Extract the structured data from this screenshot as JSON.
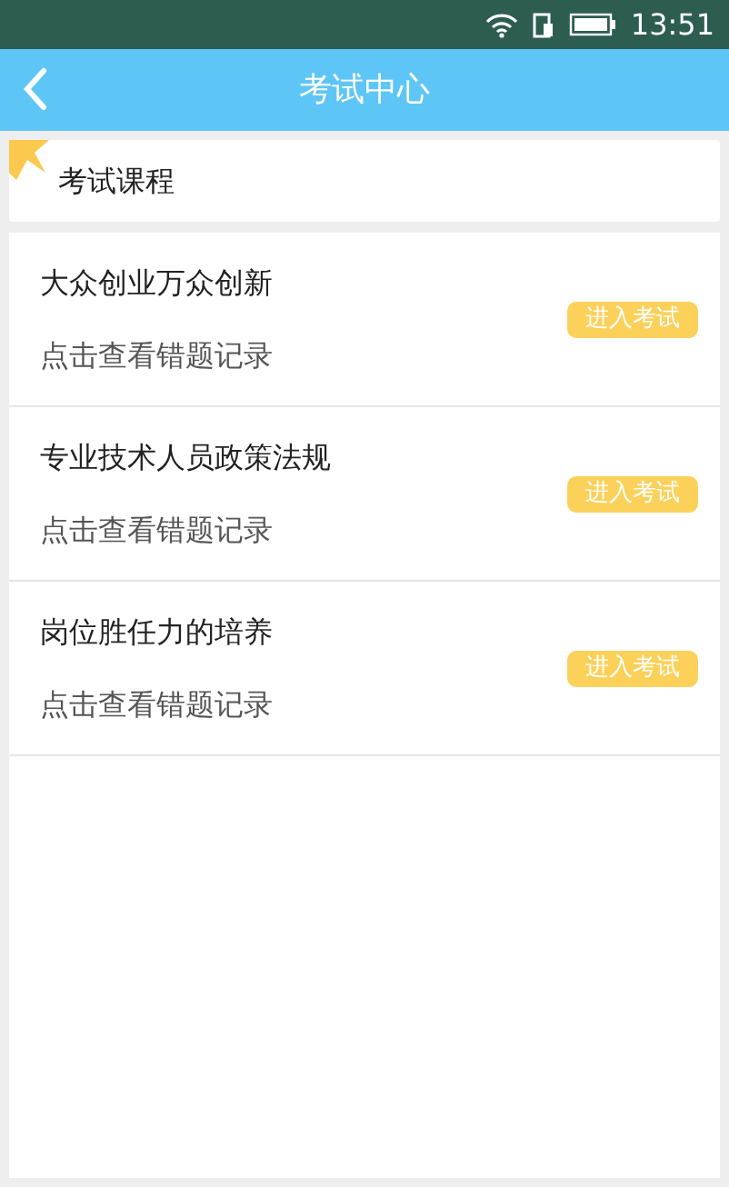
{
  "status_bar": {
    "time": "13:51"
  },
  "app_bar": {
    "title": "考试中心"
  },
  "section": {
    "title": "考试课程"
  },
  "courses": [
    {
      "name": "大众创业万众创新",
      "link": "点击查看错题记录",
      "button": "进入考试"
    },
    {
      "name": "专业技术人员政策法规",
      "link": "点击查看错题记录",
      "button": "进入考试"
    },
    {
      "name": "岗位胜任力的培养",
      "link": "点击查看错题记录",
      "button": "进入考试"
    }
  ]
}
